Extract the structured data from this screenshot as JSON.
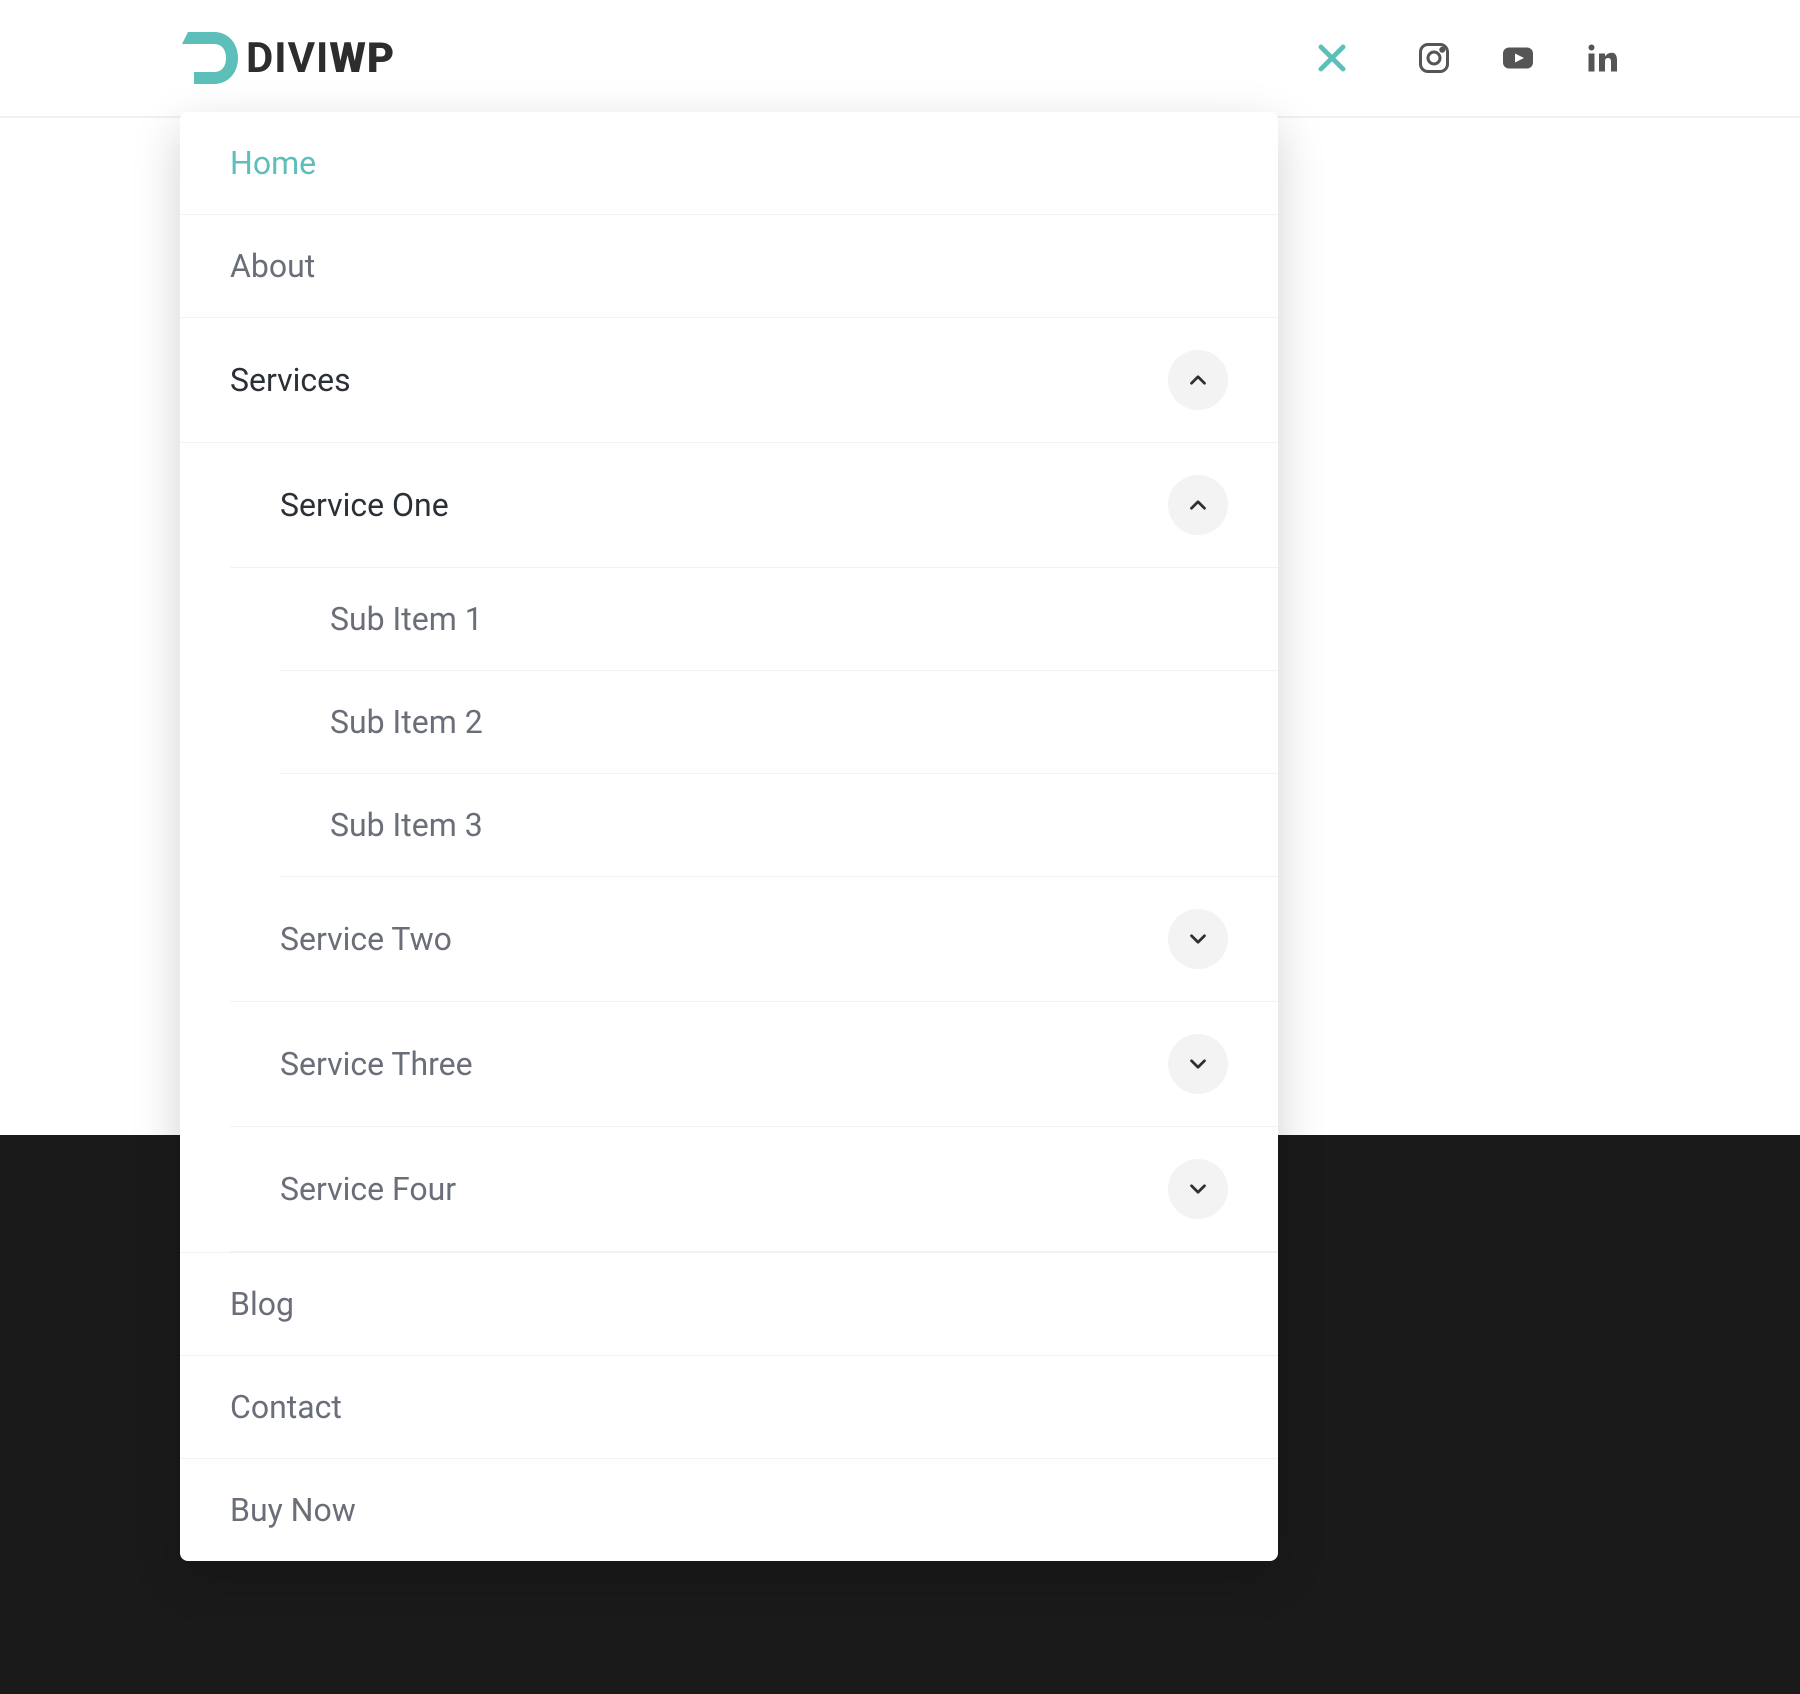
{
  "logo": {
    "text_primary": "DIVI",
    "text_secondary": "WP",
    "accent_color": "#5cbfb9"
  },
  "header": {
    "close_label": "Close menu",
    "social": [
      {
        "name": "instagram"
      },
      {
        "name": "youtube"
      },
      {
        "name": "linkedin"
      }
    ]
  },
  "menu": {
    "items": [
      {
        "label": "Home",
        "style": "highlight"
      },
      {
        "label": "About",
        "style": "muted"
      },
      {
        "label": "Services",
        "style": "dark",
        "expanded": true
      },
      {
        "label": "Service One",
        "style": "dark",
        "level": 1,
        "expanded": true
      },
      {
        "label": "Sub Item 1",
        "style": "muted",
        "level": 2
      },
      {
        "label": "Sub Item 2",
        "style": "muted",
        "level": 2
      },
      {
        "label": "Sub Item 3",
        "style": "muted",
        "level": 2
      },
      {
        "label": "Service Two",
        "style": "muted",
        "level": 1,
        "expanded": false
      },
      {
        "label": "Service Three",
        "style": "muted",
        "level": 1,
        "expanded": false
      },
      {
        "label": "Service Four",
        "style": "muted",
        "level": 1,
        "expanded": false
      },
      {
        "label": "Blog",
        "style": "muted"
      },
      {
        "label": "Contact",
        "style": "muted"
      },
      {
        "label": "Buy Now",
        "style": "muted"
      }
    ]
  }
}
